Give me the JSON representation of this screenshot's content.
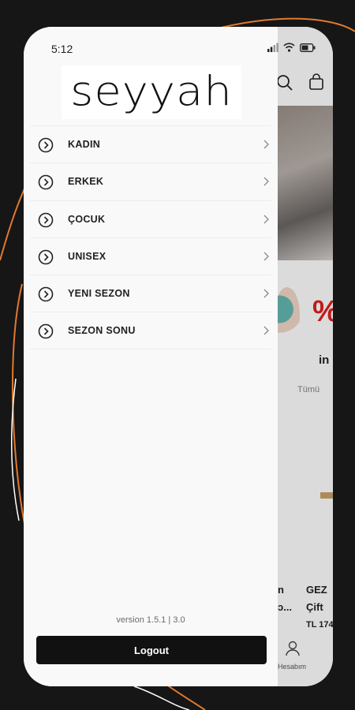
{
  "status_bar": {
    "time": "5:12"
  },
  "brand": {
    "logo_text": "seyyah"
  },
  "menu": {
    "items": [
      {
        "label": "KADIN"
      },
      {
        "label": "ERKEK"
      },
      {
        "label": "ÇOCUK"
      },
      {
        "label": "UNISEX"
      },
      {
        "label": "YENI SEZON"
      },
      {
        "label": "SEZON SONU"
      }
    ]
  },
  "footer": {
    "version": "version 1.5.1 | 3.0",
    "logout_label": "Logout"
  },
  "background_app": {
    "percent_text": "%",
    "label_in": "in",
    "tab_all": "Tümü",
    "card1_line1": "n",
    "card1_line2": "ɔ...",
    "card2_line1": "GEZ",
    "card2_line2": "Çift",
    "card2_price": "TL 174",
    "account_label": "Hesabım"
  },
  "colors": {
    "accent": "#e07a2f",
    "background": "#161616",
    "button": "#111111"
  }
}
